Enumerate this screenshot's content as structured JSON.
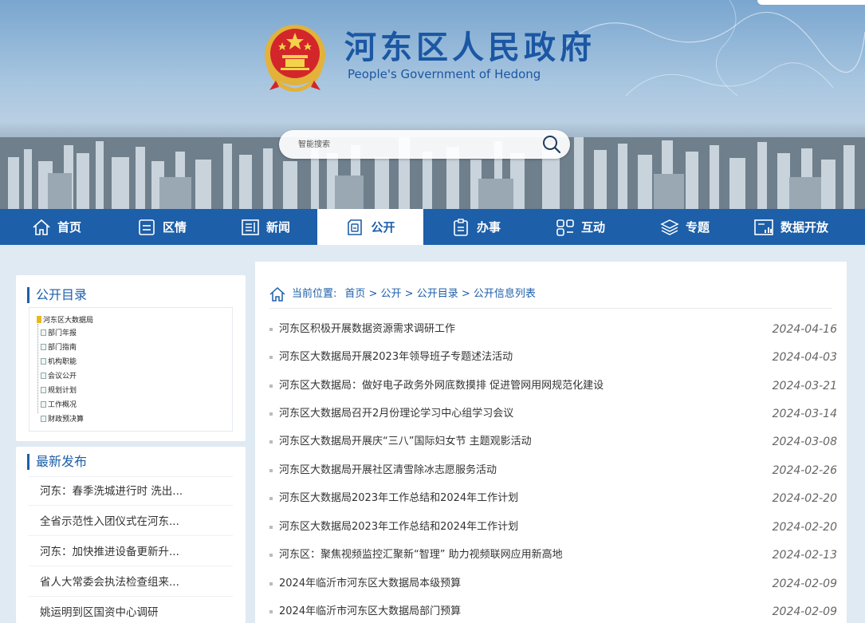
{
  "header": {
    "title": "河东区人民政府",
    "subtitle": "People's Government of Hedong",
    "search_placeholder": "智能搜索"
  },
  "nav": {
    "items": [
      {
        "label": "首页",
        "icon": "home-icon"
      },
      {
        "label": "区情",
        "icon": "document-icon"
      },
      {
        "label": "新闻",
        "icon": "news-icon"
      },
      {
        "label": "公开",
        "icon": "disclosure-icon"
      },
      {
        "label": "办事",
        "icon": "clipboard-icon"
      },
      {
        "label": "互动",
        "icon": "interaction-icon"
      },
      {
        "label": "专题",
        "icon": "layers-icon"
      },
      {
        "label": "数据开放",
        "icon": "data-chart-icon"
      }
    ],
    "active_label": "公开"
  },
  "sidebar": {
    "catalog_title": "公开目录",
    "tree_root": "河东区大数据局",
    "tree_items": [
      "部门年报",
      "部门指南",
      "机构职能",
      "会议公开",
      "规划计划",
      "工作概况",
      "财政预决算"
    ],
    "latest_title": "最新发布",
    "latest": [
      "河东：春季洗城进行时 洗出...",
      "全省示范性入团仪式在河东...",
      "河东：加快推进设备更新升...",
      "省人大常委会执法检查组来...",
      "姚运明到区国资中心调研"
    ]
  },
  "breadcrumb": {
    "label": "当前位置:",
    "path": "首页 > 公开 > 公开目录 > 公开信息列表"
  },
  "list": [
    {
      "title": "河东区积极开展数据资源需求调研工作",
      "date": "2024-04-16"
    },
    {
      "title": "河东区大数据局开展2023年领导班子专题述法活动",
      "date": "2024-04-03"
    },
    {
      "title": "河东区大数据局：做好电子政务外网底数摸排 促进管网用网规范化建设",
      "date": "2024-03-21"
    },
    {
      "title": "河东区大数据局召开2月份理论学习中心组学习会议",
      "date": "2024-03-14"
    },
    {
      "title": "河东区大数据局开展庆“三八”国际妇女节 主题观影活动",
      "date": "2024-03-08"
    },
    {
      "title": "河东区大数据局开展社区清雪除冰志愿服务活动",
      "date": "2024-02-26"
    },
    {
      "title": "河东区大数据局2023年工作总结和2024年工作计划",
      "date": "2024-02-20"
    },
    {
      "title": "河东区大数据局2023年工作总结和2024年工作计划",
      "date": "2024-02-20"
    },
    {
      "title": "河东区：聚焦视频监控汇聚新“智理” 助力视频联网应用新高地",
      "date": "2024-02-13"
    },
    {
      "title": "2024年临沂市河东区大数据局本级预算",
      "date": "2024-02-09"
    },
    {
      "title": "2024年临沂市河东区大数据局部门预算",
      "date": "2024-02-09"
    }
  ],
  "colors": {
    "primary": "#1d5fa9",
    "date": "#666666",
    "page_bg": "#dfeaf3"
  }
}
